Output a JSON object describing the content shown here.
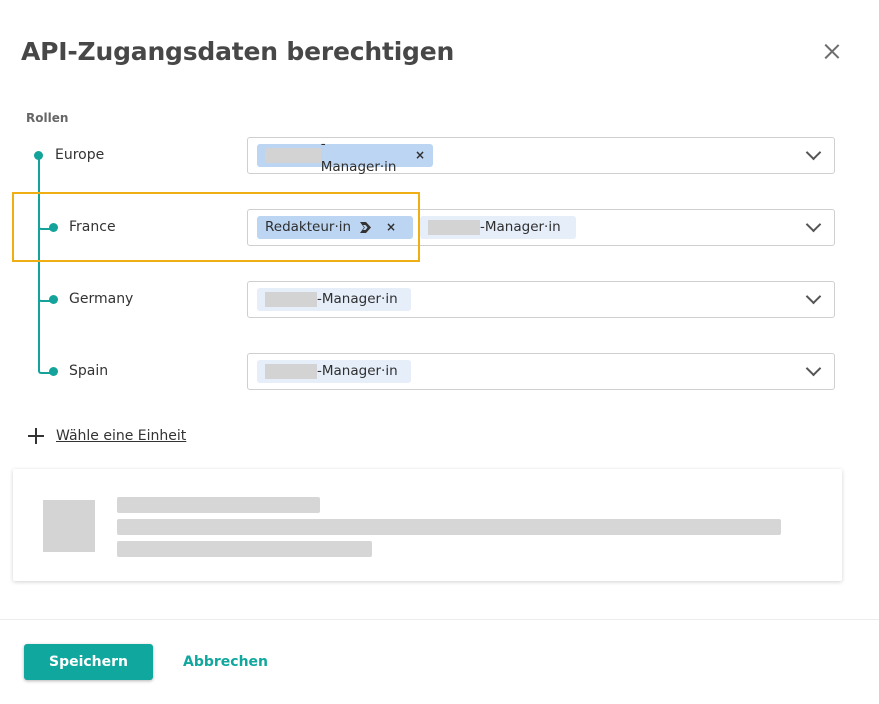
{
  "dialog": {
    "title": "API-Zugangsdaten berechtigen",
    "close_icon": "close-icon"
  },
  "roles": {
    "section_label": "Rollen",
    "units": [
      {
        "name": "Europe",
        "chips": [
          {
            "text": "-Manager·in",
            "selected": true,
            "removable": true
          }
        ]
      },
      {
        "name": "France",
        "chips": [
          {
            "text": "Redakteur·in",
            "selected": true,
            "removable": true,
            "icon": "role-flag-icon"
          },
          {
            "text": "-Manager·in",
            "selected": false,
            "removable": false
          }
        ]
      },
      {
        "name": "Germany",
        "chips": [
          {
            "text": "-Manager·in",
            "selected": false,
            "removable": false
          }
        ]
      },
      {
        "name": "Spain",
        "chips": [
          {
            "text": "-Manager·in",
            "selected": false,
            "removable": false
          }
        ]
      }
    ],
    "chip_remove_symbol": "×"
  },
  "add_unit": {
    "label": "Wähle eine Einheit",
    "icon": "plus-icon"
  },
  "footer": {
    "save_label": "Speichern",
    "cancel_label": "Abbrechen"
  },
  "colors": {
    "accent": "#10a89e",
    "highlight": "#efae14",
    "chip_selected": "#bcd5f2",
    "chip_inherited": "#e5eef9"
  }
}
